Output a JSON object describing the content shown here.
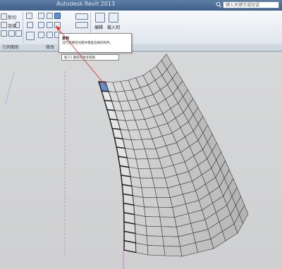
{
  "window": {
    "title": "Autodesk Revit 2013"
  },
  "search": {
    "placeholder": "键入关键字或短语"
  },
  "ribbon": {
    "clipboard": {
      "cut": "剪切",
      "join": "连接"
    },
    "panels": {
      "geometry": "几何图形",
      "modify": "修改"
    },
    "edit_button": "编辑",
    "load_button": "载入到"
  },
  "tooltip": {
    "title": "复制",
    "description": "沿行或路径创建并重复选择的构件。",
    "help_hint": "按 F1 键获得更多帮助"
  },
  "colors": {
    "accent": "#5f8fd0",
    "arrow": "#e0302b",
    "panel_face": "#dcdcdc",
    "panel_edge": "#1b1b1b"
  }
}
